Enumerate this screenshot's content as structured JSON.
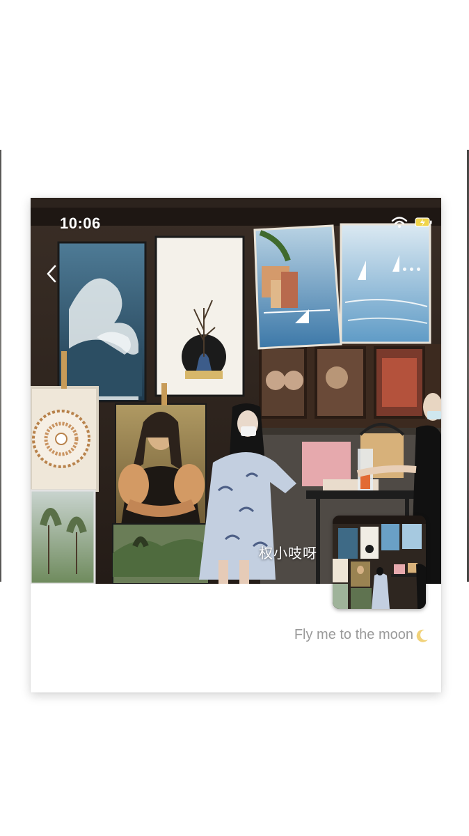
{
  "status_bar": {
    "time": "10:06"
  },
  "icons": {
    "back": "chevron-left-icon",
    "wifi": "wifi-icon",
    "battery": "battery-charging-icon",
    "more": "more-dots-icon",
    "moon": "crescent-moon-icon"
  },
  "photo": {
    "watermark": "权小吱呀"
  },
  "caption": {
    "text": "Fly me to the moon"
  },
  "colors": {
    "caption": "#9a9a9a",
    "card_background": "#ffffff",
    "overlay_text": "#ffffff"
  }
}
